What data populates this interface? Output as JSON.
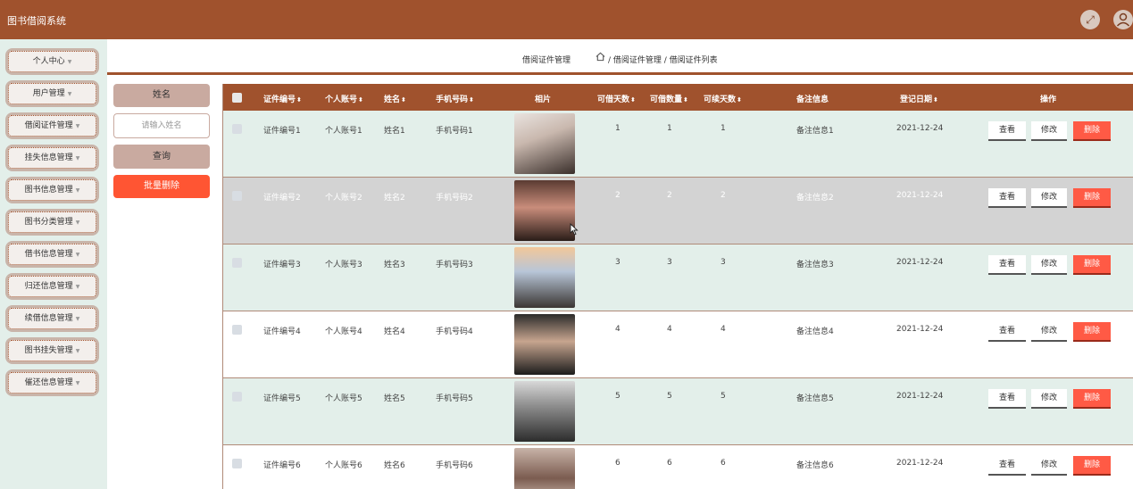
{
  "app": {
    "title": "图书借阅系统"
  },
  "header_icons": [
    "expand-icon",
    "user-avatar-icon"
  ],
  "sidebar": {
    "items": [
      {
        "label": "个人中心"
      },
      {
        "label": "用户管理"
      },
      {
        "label": "借阅证件管理"
      },
      {
        "label": "挂失信息管理"
      },
      {
        "label": "图书信息管理"
      },
      {
        "label": "图书分类管理"
      },
      {
        "label": "借书信息管理"
      },
      {
        "label": "归还信息管理"
      },
      {
        "label": "续借信息管理"
      },
      {
        "label": "图书挂失管理"
      },
      {
        "label": "催还信息管理"
      }
    ]
  },
  "breadcrumb": {
    "title": "借阅证件管理",
    "path": "/ 借阅证件管理 / 借阅证件列表"
  },
  "filter": {
    "name_label": "姓名",
    "name_placeholder": "请输入姓名",
    "query_button": "查询",
    "batch_delete_button": "批量删除"
  },
  "table": {
    "columns": [
      "证件编号",
      "个人账号",
      "姓名",
      "手机号码",
      "相片",
      "可借天数",
      "可借数量",
      "可续天数",
      "备注信息",
      "登记日期",
      "操作"
    ],
    "actions": {
      "view": "查看",
      "edit": "修改",
      "delete": "删除"
    },
    "rows": [
      {
        "cert_no": "证件编号1",
        "account": "个人账号1",
        "name": "姓名1",
        "phone": "手机号码1",
        "days": "1",
        "qty": "1",
        "renew": "1",
        "remark": "备注信息1",
        "date": "2021-12-24"
      },
      {
        "cert_no": "证件编号2",
        "account": "个人账号2",
        "name": "姓名2",
        "phone": "手机号码2",
        "days": "2",
        "qty": "2",
        "renew": "2",
        "remark": "备注信息2",
        "date": "2021-12-24"
      },
      {
        "cert_no": "证件编号3",
        "account": "个人账号3",
        "name": "姓名3",
        "phone": "手机号码3",
        "days": "3",
        "qty": "3",
        "renew": "3",
        "remark": "备注信息3",
        "date": "2021-12-24"
      },
      {
        "cert_no": "证件编号4",
        "account": "个人账号4",
        "name": "姓名4",
        "phone": "手机号码4",
        "days": "4",
        "qty": "4",
        "renew": "4",
        "remark": "备注信息4",
        "date": "2021-12-24"
      },
      {
        "cert_no": "证件编号5",
        "account": "个人账号5",
        "name": "姓名5",
        "phone": "手机号码5",
        "days": "5",
        "qty": "5",
        "renew": "5",
        "remark": "备注信息5",
        "date": "2021-12-24"
      },
      {
        "cert_no": "证件编号6",
        "account": "个人账号6",
        "name": "姓名6",
        "phone": "手机号码6",
        "days": "6",
        "qty": "6",
        "renew": "6",
        "remark": "备注信息6",
        "date": "2021-12-24"
      }
    ]
  },
  "colors": {
    "brand": "#a0522d",
    "sidebar_bg": "#e3efea",
    "row_light": "#e3efea",
    "row_white": "#ffffff",
    "row_hover": "#d3d3d3",
    "delete": "#ff5a45"
  }
}
